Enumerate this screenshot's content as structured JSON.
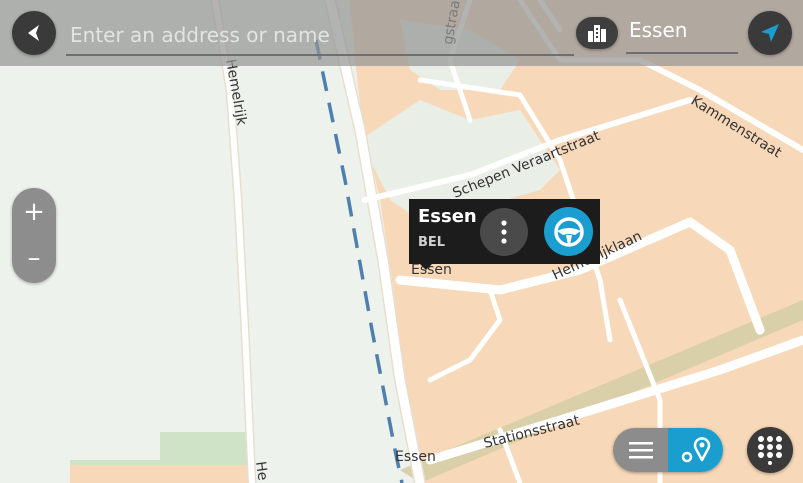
{
  "search": {
    "placeholder": "Enter an address or name",
    "location": "Essen"
  },
  "map": {
    "street_labels": {
      "top_street": "gstraat",
      "hemelrijk_top": "Hemelrijk",
      "schepen": "Schepen Veraartstraat",
      "kammen": "Kammenstraat",
      "hemelrijklaan": "Hemelrijklaan",
      "station": "Stationsstraat",
      "hemelrijk_bottom": "He"
    },
    "place_labels": {
      "essen_center": "Essen",
      "essen_station": "Essen"
    }
  },
  "zoom": {
    "in_label": "+",
    "out_label": "–"
  },
  "popup": {
    "title": "Essen",
    "subtitle": "BEL"
  },
  "icons": {
    "back": "back-arrow-icon",
    "city": "city-buildings-icon",
    "navigate": "navigation-arrow-icon",
    "more": "more-vertical-icon",
    "drive": "steering-wheel-icon",
    "list": "list-icon",
    "route_map": "route-map-icon",
    "keypad": "keypad-icon"
  },
  "colors": {
    "accent": "#1a9ed0",
    "built_up_area": "#f7d8b8",
    "railway": "#4e7fae",
    "park": "#cfe3c6"
  }
}
